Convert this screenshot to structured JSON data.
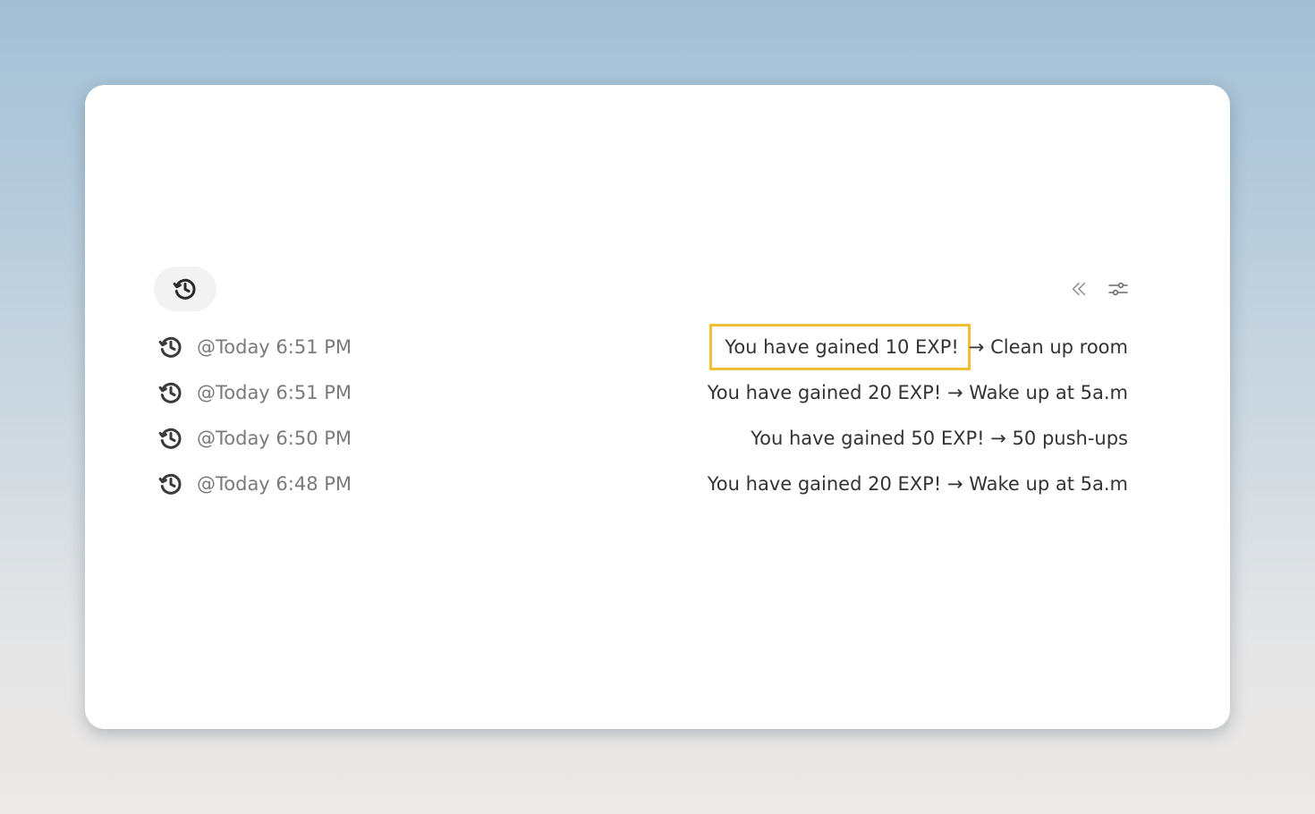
{
  "toolbar": {
    "history_icon": "history-icon",
    "collapse_icon": "double-chevron-left-icon",
    "settings_icon": "sliders-icon"
  },
  "highlight_color": "#f2c035",
  "log": [
    {
      "time": "@Today 6:51 PM",
      "message": "You have gained 10 EXP!",
      "arrow": "→",
      "task": "Clean up room"
    },
    {
      "time": "@Today 6:51 PM",
      "message": "You have gained 20 EXP!",
      "arrow": "→",
      "task": "Wake up at 5a.m"
    },
    {
      "time": "@Today 6:50 PM",
      "message": "You have gained 50 EXP!",
      "arrow": "→",
      "task": "50 push-ups"
    },
    {
      "time": "@Today 6:48 PM",
      "message": "You have gained 20 EXP!",
      "arrow": "→",
      "task": "Wake up at 5a.m"
    }
  ]
}
